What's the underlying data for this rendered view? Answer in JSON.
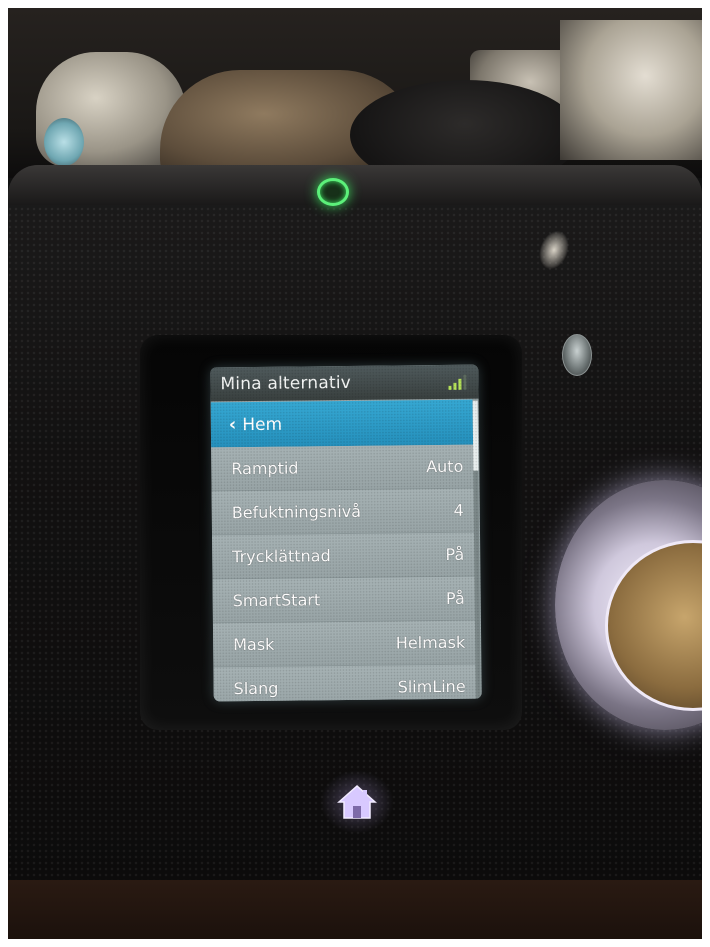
{
  "screen": {
    "title": "Mina alternativ",
    "back": {
      "icon": "chevron-left-icon",
      "label": "Hem"
    },
    "items": [
      {
        "label": "Ramptid",
        "value": "Auto"
      },
      {
        "label": "Befuktningsnivå",
        "value": "4"
      },
      {
        "label": "Trycklättnad",
        "value": "På"
      },
      {
        "label": "SmartStart",
        "value": "På"
      },
      {
        "label": "Mask",
        "value": "Helmask"
      },
      {
        "label": "Slang",
        "value": "SlimLine"
      }
    ],
    "signal_icon": "signal-strength-icon"
  },
  "device": {
    "home_icon": "home-icon",
    "power_indicator_color": "#5cf07a",
    "selection_color": "#2b9dc8"
  }
}
